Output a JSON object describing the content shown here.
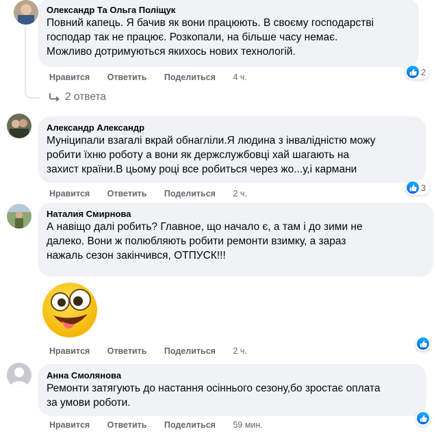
{
  "comments": [
    {
      "author": "Олександр Та Ольга Поліщук",
      "lines": [
        "Повний капець. Я бачив як вони працюють. В своєму господарстві",
        "господар так не працює. Розкопали, на більше часу немає.",
        "Можливо дотримуються якихось нових технологій."
      ],
      "like": "Нравится",
      "reply": "Ответить",
      "share": "Поделиться",
      "time": "4 ч.",
      "reactions": "2",
      "replies_label": "2 ответа"
    },
    {
      "author": "Александр Александр",
      "lines": [
        "Муніципали взагалі вкрай обнагліли.Я людина з інвалідністю можу",
        "робити їхню роботу а вони як держслужбовці хай шагають на",
        "захист країни.В цьому році все робиться через жо...у,і кармани"
      ],
      "like": "Нравится",
      "reply": "Ответить",
      "share": "Поделиться",
      "time": "2 ч.",
      "reactions": "3"
    },
    {
      "author": "Наталия Смирнова",
      "lines": [
        "А навіщо далі робить? Главное, що начало є, а там і до зими не",
        "далеко. Вони ж полюбляють робити ремонти взимку, а зараз",
        "нажаль сезон закінчився, ОТПУСК!!!"
      ],
      "like": "Нравится",
      "reply": "Ответить",
      "share": "Поделиться",
      "time": "2 ч.",
      "reactions": ""
    },
    {
      "author": "Анна Смолянова",
      "lines": [
        "Ремонти затягують до настання осіннього сезону,бо зростає оплата",
        "за умови роботи."
      ],
      "like": "Нравится",
      "reply": "Ответить",
      "share": "Поделиться",
      "time": "59 мин.",
      "reactions": ""
    }
  ],
  "colors": {
    "bubble": "#f0f2f5",
    "meta": "#65676b",
    "like_blue": "#0571ed"
  },
  "icons": [
    "like-icon",
    "reply-arrow-icon",
    "crazy-face-emoji",
    "default-avatar-icon"
  ]
}
